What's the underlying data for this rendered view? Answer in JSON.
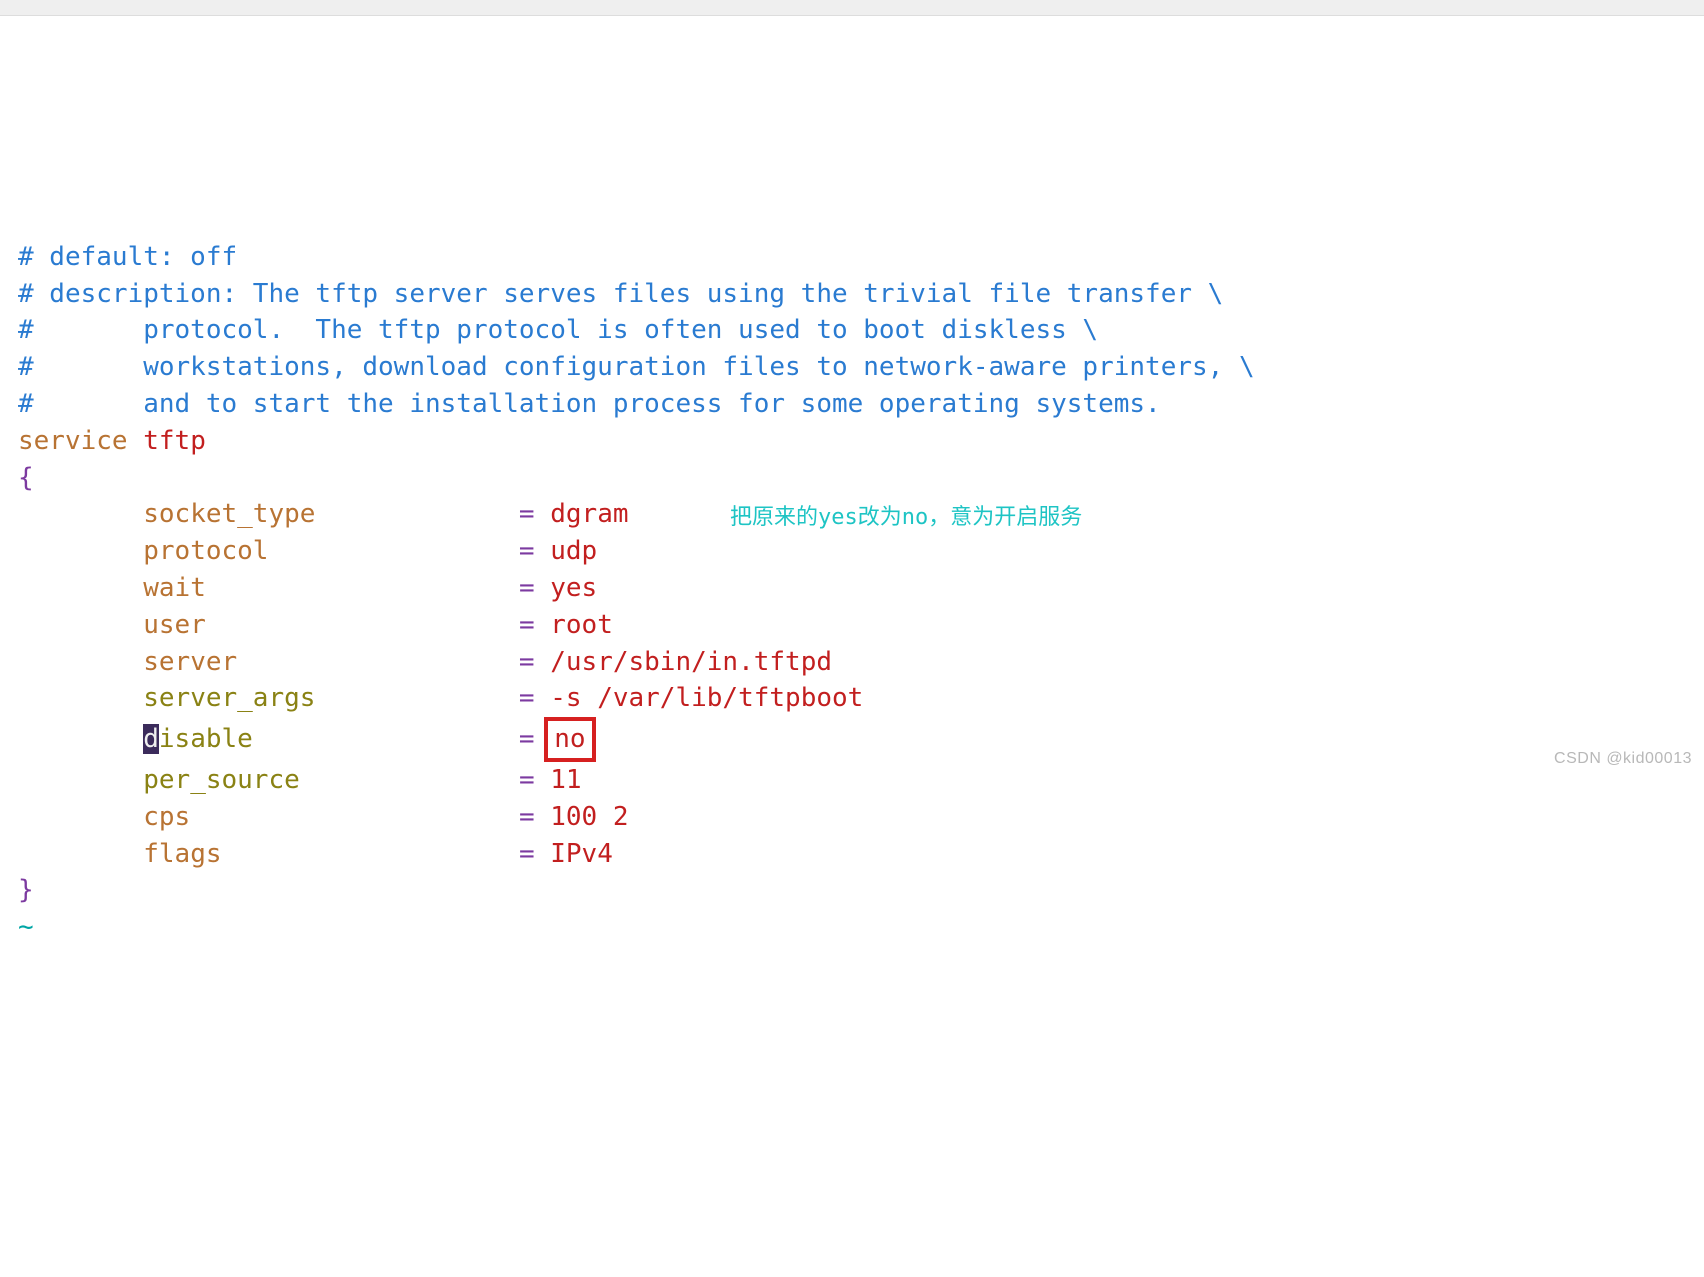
{
  "comments": {
    "l1": "# default: off",
    "l2": "# description: The tftp server serves files using the trivial file transfer \\",
    "l3": "#       protocol.  The tftp protocol is often used to boot diskless \\",
    "l4": "#       workstations, download configuration files to network-aware printers, \\",
    "l5": "#       and to start the installation process for some operating systems."
  },
  "service_kw": "service",
  "service_name": "tftp",
  "brace_open": "{",
  "brace_close": "}",
  "tilde": "~",
  "eq": "=",
  "params": {
    "socket_type": {
      "key": "socket_type",
      "value": "dgram"
    },
    "protocol": {
      "key": "protocol",
      "value": "udp"
    },
    "wait": {
      "key": "wait",
      "value": "yes"
    },
    "user": {
      "key": "user",
      "value": "root"
    },
    "server": {
      "key": "server",
      "value": "/usr/sbin/in.tftpd"
    },
    "server_args": {
      "key": "server_args",
      "value": "-s /var/lib/tftpboot"
    },
    "disable": {
      "key_first": "d",
      "key_rest": "isable",
      "value": "no"
    },
    "per_source": {
      "key": "per_source",
      "value": "11"
    },
    "cps": {
      "key": "cps",
      "value": "100 2"
    },
    "flags": {
      "key": "flags",
      "value": "IPv4"
    }
  },
  "annotation": "把原来的yes改为no，意为开启服务",
  "watermark": "CSDN @kid00013"
}
